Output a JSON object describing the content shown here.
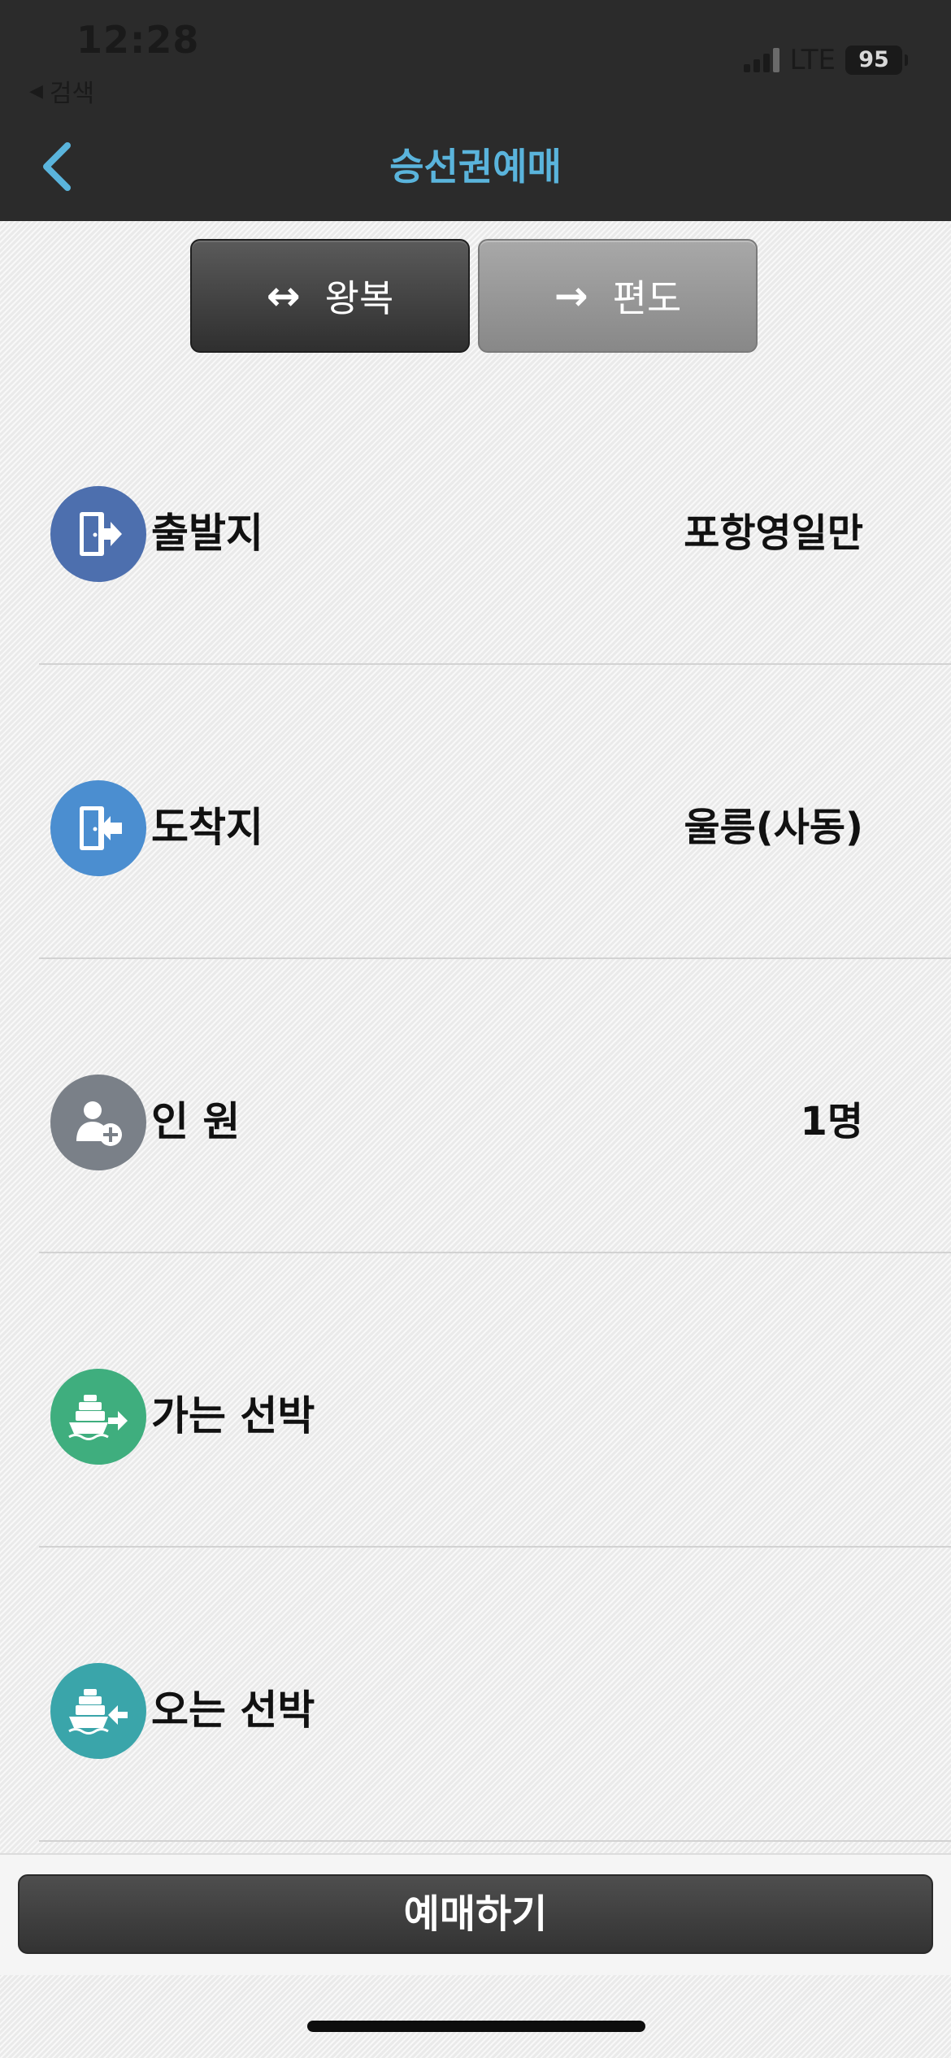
{
  "status_bar": {
    "time": "12:28",
    "back_app": "검색",
    "network": "LTE",
    "battery": "95"
  },
  "nav": {
    "title": "승선권예매",
    "accent_color": "#5ab4dc"
  },
  "trip_toggle": {
    "options": [
      {
        "label": "왕복",
        "icon": "arrow-left-right-icon",
        "selected": true
      },
      {
        "label": "편도",
        "icon": "arrow-right-icon",
        "selected": false
      }
    ]
  },
  "rows": [
    {
      "label": "출발지",
      "value": "포항영일만",
      "icon": "exit-door-icon",
      "color": "#4d6fae"
    },
    {
      "label": "도착지",
      "value": "울릉(사동)",
      "icon": "enter-door-icon",
      "color": "#4b8ed0"
    },
    {
      "label": "인 원",
      "value": "1명",
      "icon": "person-add-icon",
      "color": "#7a8088"
    },
    {
      "label": "가는 선박",
      "value": "",
      "icon": "ship-depart-icon",
      "color": "#3fae7e"
    },
    {
      "label": "오는 선박",
      "value": "",
      "icon": "ship-return-icon",
      "color": "#3aa5aa"
    }
  ],
  "reserve_button": "예매하기"
}
